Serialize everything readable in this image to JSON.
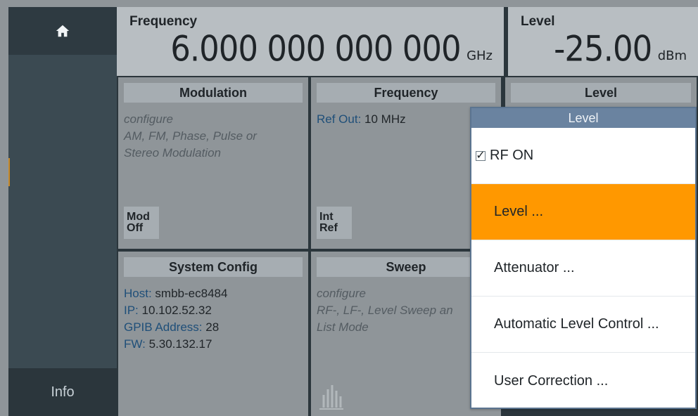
{
  "sidebar": {
    "home_icon": "home-icon",
    "info_label": "Info"
  },
  "display": {
    "frequency_label": "Frequency",
    "frequency_value": "6.000 000 000 000",
    "frequency_unit": "GHz",
    "level_label": "Level",
    "level_value": "-25.00",
    "level_unit": "dBm"
  },
  "tiles": {
    "modulation": {
      "title": "Modulation",
      "line1": "configure",
      "line2": "AM, FM, Phase, Pulse or",
      "line3": "Stereo Modulation",
      "button_line1": "Mod",
      "button_line2": "Off"
    },
    "frequency": {
      "title": "Frequency",
      "ref_out_key": "Ref Out:",
      "ref_out_val": "10 MHz",
      "button_line1": "Int",
      "button_line2": "Ref"
    },
    "level": {
      "title": "Level"
    },
    "system_config": {
      "title": "System Config",
      "host_key": "Host:",
      "host_val": "smbb-ec8484",
      "ip_key": "IP:",
      "ip_val": "10.102.52.32",
      "gpib_key": "GPIB Address:",
      "gpib_val": "28",
      "fw_key": "FW:",
      "fw_val": "5.30.132.17"
    },
    "sweep": {
      "title": "Sweep",
      "line1": "configure",
      "line2": "RF-, LF-, Level Sweep an",
      "line3": "List Mode"
    }
  },
  "level_menu": {
    "title": "Level",
    "rf_on_label": "RF ON",
    "items": [
      "Level ...",
      "Attenuator ...",
      "Automatic Level Control ...",
      "User Correction ..."
    ]
  },
  "colors": {
    "accent_orange": "#ff9800",
    "menu_header": "#6a83a0"
  }
}
